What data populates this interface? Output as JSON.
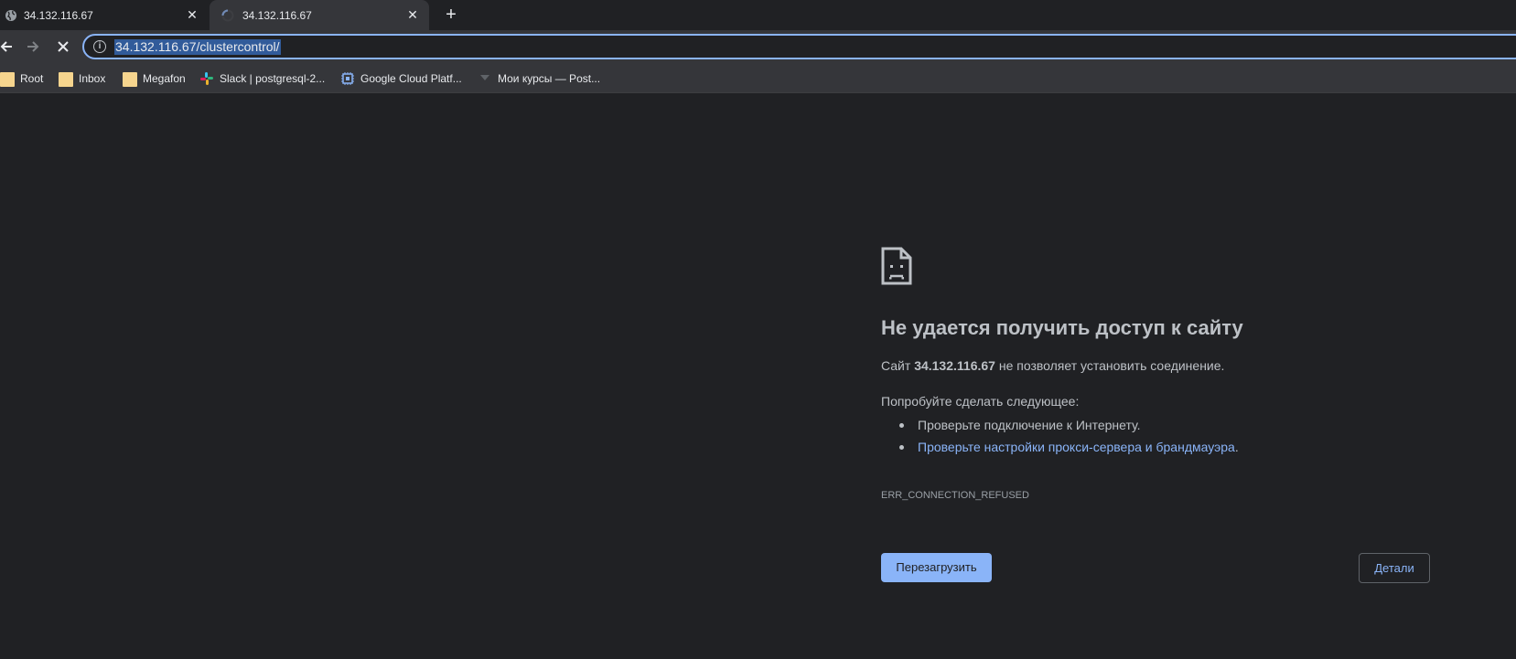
{
  "tabs": [
    {
      "title": "34.132.116.67",
      "active": false,
      "favicon": "globe-icon"
    },
    {
      "title": "34.132.116.67",
      "active": true,
      "favicon": "loading-spinner-icon"
    }
  ],
  "toolbar": {
    "url": "34.132.116.67/clustercontrol/",
    "site_info_icon": "info-icon"
  },
  "bookmarks": [
    {
      "label": "Root",
      "icon": "folder-icon"
    },
    {
      "label": "Inbox",
      "icon": "folder-icon"
    },
    {
      "label": "Megafon",
      "icon": "folder-icon"
    },
    {
      "label": "Slack | postgresql-2...",
      "icon": "slack-icon"
    },
    {
      "label": "Google Cloud Platf...",
      "icon": "chip-icon"
    },
    {
      "label": "Мои курсы — Post...",
      "icon": "bookmark-favicon-icon"
    }
  ],
  "error_page": {
    "headline": "Не удается получить доступ к сайту",
    "desc_prefix": "Сайт ",
    "desc_host": "34.132.116.67",
    "desc_suffix": " не позволяет установить соединение.",
    "suggest_heading": "Попробуйте сделать следующее:",
    "suggestion_1": "Проверьте подключение к Интернету.",
    "suggestion_2_link": "Проверьте настройки прокси-сервера и брандмауэра",
    "suggestion_2_tail": ".",
    "error_code": "ERR_CONNECTION_REFUSED",
    "reload_label": "Перезагрузить",
    "details_label": "Детали"
  },
  "colors": {
    "background": "#202124",
    "toolbar": "#35363a",
    "accent": "#8ab4f8",
    "text": "#bdc1c6"
  }
}
